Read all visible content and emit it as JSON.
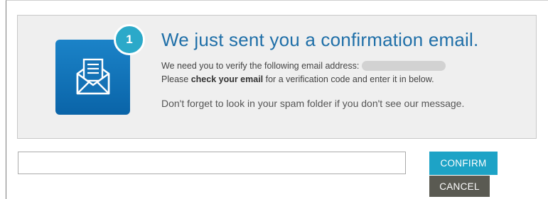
{
  "notice": {
    "step_number": "1",
    "title": "We just sent you a confirmation email.",
    "verify_text": "We need you to verify the following email address:",
    "check_prefix": "Please ",
    "check_bold": "check your email",
    "check_suffix": " for a verification code and enter it in below.",
    "spam_text": "Don't forget to look in your spam folder if you don't see our message.",
    "icon": "envelope-icon",
    "accent_color": "#1f6fa8",
    "badge_color": "#2ba9c9"
  },
  "form": {
    "code_value": "",
    "confirm_label": "CONFIRM",
    "cancel_label": "CANCEL",
    "confirm_color": "#1da3c6",
    "cancel_color": "#5a5a52"
  }
}
